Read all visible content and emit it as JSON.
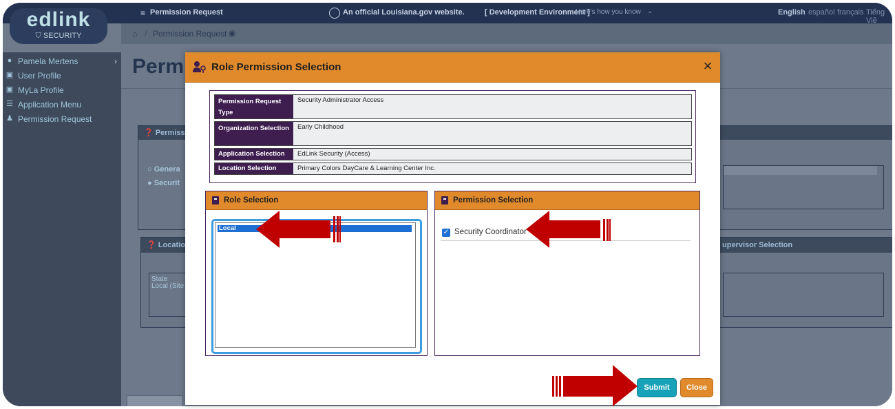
{
  "app": {
    "logo_main": "edlink",
    "logo_sub": "SECURITY",
    "topbar_menu": "Permission Request",
    "gov_notice": "An official Louisiana.gov website.",
    "env_notice": "[ Development Environment ]",
    "how_know": "Here's how you know",
    "languages": [
      "English",
      "español",
      "français",
      "Tiếng Việ"
    ]
  },
  "breadcrumb": {
    "page": "Permission Request"
  },
  "sidebar": {
    "items": [
      {
        "label": "Pamela Mertens",
        "icon": "user-circle-icon"
      },
      {
        "label": "User Profile",
        "icon": "id-card-icon"
      },
      {
        "label": "MyLa Profile",
        "icon": "id-card-icon"
      },
      {
        "label": "Application Menu",
        "icon": "list-icon"
      },
      {
        "label": "Permission Request",
        "icon": "users-key-icon"
      }
    ]
  },
  "background": {
    "page_title": "Permis",
    "panel1_head": "Permiss",
    "option_general": "Genera",
    "option_security": "Securit",
    "panel2_head": "Locatio",
    "state_label": "State",
    "state_value": "Local (Site",
    "supervisor_head": "upervisor Selection"
  },
  "modal": {
    "title": "Role Permission Selection",
    "close_symbol": "×",
    "summary": [
      {
        "label": "Permission Request Type",
        "value": "Security Administrator Access"
      },
      {
        "label": "Organization Selection",
        "value": "Early Childhood"
      },
      {
        "label": "Application Selection",
        "value": "EdLink Security (Access)"
      },
      {
        "label": "Location Selection",
        "value": "Primary Colors DayCare & Learning Center Inc."
      }
    ],
    "role_section": {
      "title": "Role Selection",
      "options": [
        "Local"
      ],
      "selected": "Local"
    },
    "permission_section": {
      "title": "Permission Selection",
      "items": [
        {
          "label": "Security Coordinator",
          "checked": true
        }
      ]
    },
    "buttons": {
      "submit": "Submit",
      "close": "Close"
    }
  },
  "colors": {
    "header_orange": "#e18a2b",
    "label_purple": "#3e1d4f",
    "submit_teal": "#17a2b8",
    "annotation_red": "#c00000",
    "selected_blue": "#1e6fd3"
  }
}
